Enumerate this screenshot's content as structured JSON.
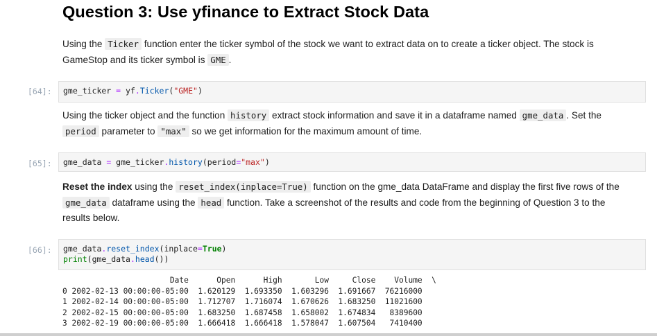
{
  "question": {
    "title": "Question 3: Use yfinance to Extract Stock Data"
  },
  "md1": {
    "t1": "Using the ",
    "c1": "Ticker",
    "t2": " function enter the ticker symbol of the stock we want to extract data on to create a ticker object. The stock is GameStop and its ticker symbol is ",
    "c2": "GME",
    "t3": "."
  },
  "cell64": {
    "prompt": "[64]:",
    "var": "gme_ticker",
    "eq": " = ",
    "obj": "yf",
    "dot": ".",
    "fn": "Ticker",
    "open": "(",
    "arg": "\"GME\"",
    "close": ")"
  },
  "md2": {
    "t1": "Using the ticker object and the function ",
    "c1": "history",
    "t2": " extract stock information and save it in a dataframe named ",
    "c2": "gme_data",
    "t3": ". Set the ",
    "c3": "period",
    "t4": " parameter to ",
    "c4": "\"max\"",
    "t5": " so we get information for the maximum amount of time."
  },
  "cell65": {
    "prompt": "[65]:",
    "var": "gme_data",
    "eq": " = ",
    "obj": "gme_ticker",
    "dot": ".",
    "fn": "history",
    "open": "(",
    "param": "period",
    "peq": "=",
    "arg": "\"max\"",
    "close": ")"
  },
  "md3": {
    "b1": "Reset the index",
    "t1": " using the ",
    "c1": "reset_index(inplace=True)",
    "t2": " function on the gme_data DataFrame and display the first five rows of the ",
    "c2": "gme_data",
    "t3": " dataframe using the ",
    "c3": "head",
    "t4": " function. Take a screenshot of the results and code from the beginning of Question 3 to the results below."
  },
  "cell66": {
    "prompt": "[66]:",
    "l1_obj": "gme_data",
    "l1_dot": ".",
    "l1_fn": "reset_index",
    "l1_open": "(",
    "l1_param": "inplace",
    "l1_eq": "=",
    "l1_val": "True",
    "l1_close": ")",
    "l2_fn": "print",
    "l2_open": "(",
    "l2_obj": "gme_data",
    "l2_dot": ".",
    "l2_method": "head",
    "l2_close": "())"
  },
  "output": {
    "headers": [
      "",
      "Date",
      "Open",
      "High",
      "Low",
      "Close",
      "Volume",
      "\\"
    ],
    "rows": [
      [
        "0",
        "2002-02-13 00:00:00-05:00",
        "1.620129",
        "1.693350",
        "1.603296",
        "1.691667",
        "76216000"
      ],
      [
        "1",
        "2002-02-14 00:00:00-05:00",
        "1.712707",
        "1.716074",
        "1.670626",
        "1.683250",
        "11021600"
      ],
      [
        "2",
        "2002-02-15 00:00:00-05:00",
        "1.683250",
        "1.687458",
        "1.658002",
        "1.674834",
        "8389600"
      ],
      [
        "3",
        "2002-02-19 00:00:00-05:00",
        "1.666418",
        "1.666418",
        "1.578047",
        "1.607504",
        "7410400"
      ]
    ]
  }
}
